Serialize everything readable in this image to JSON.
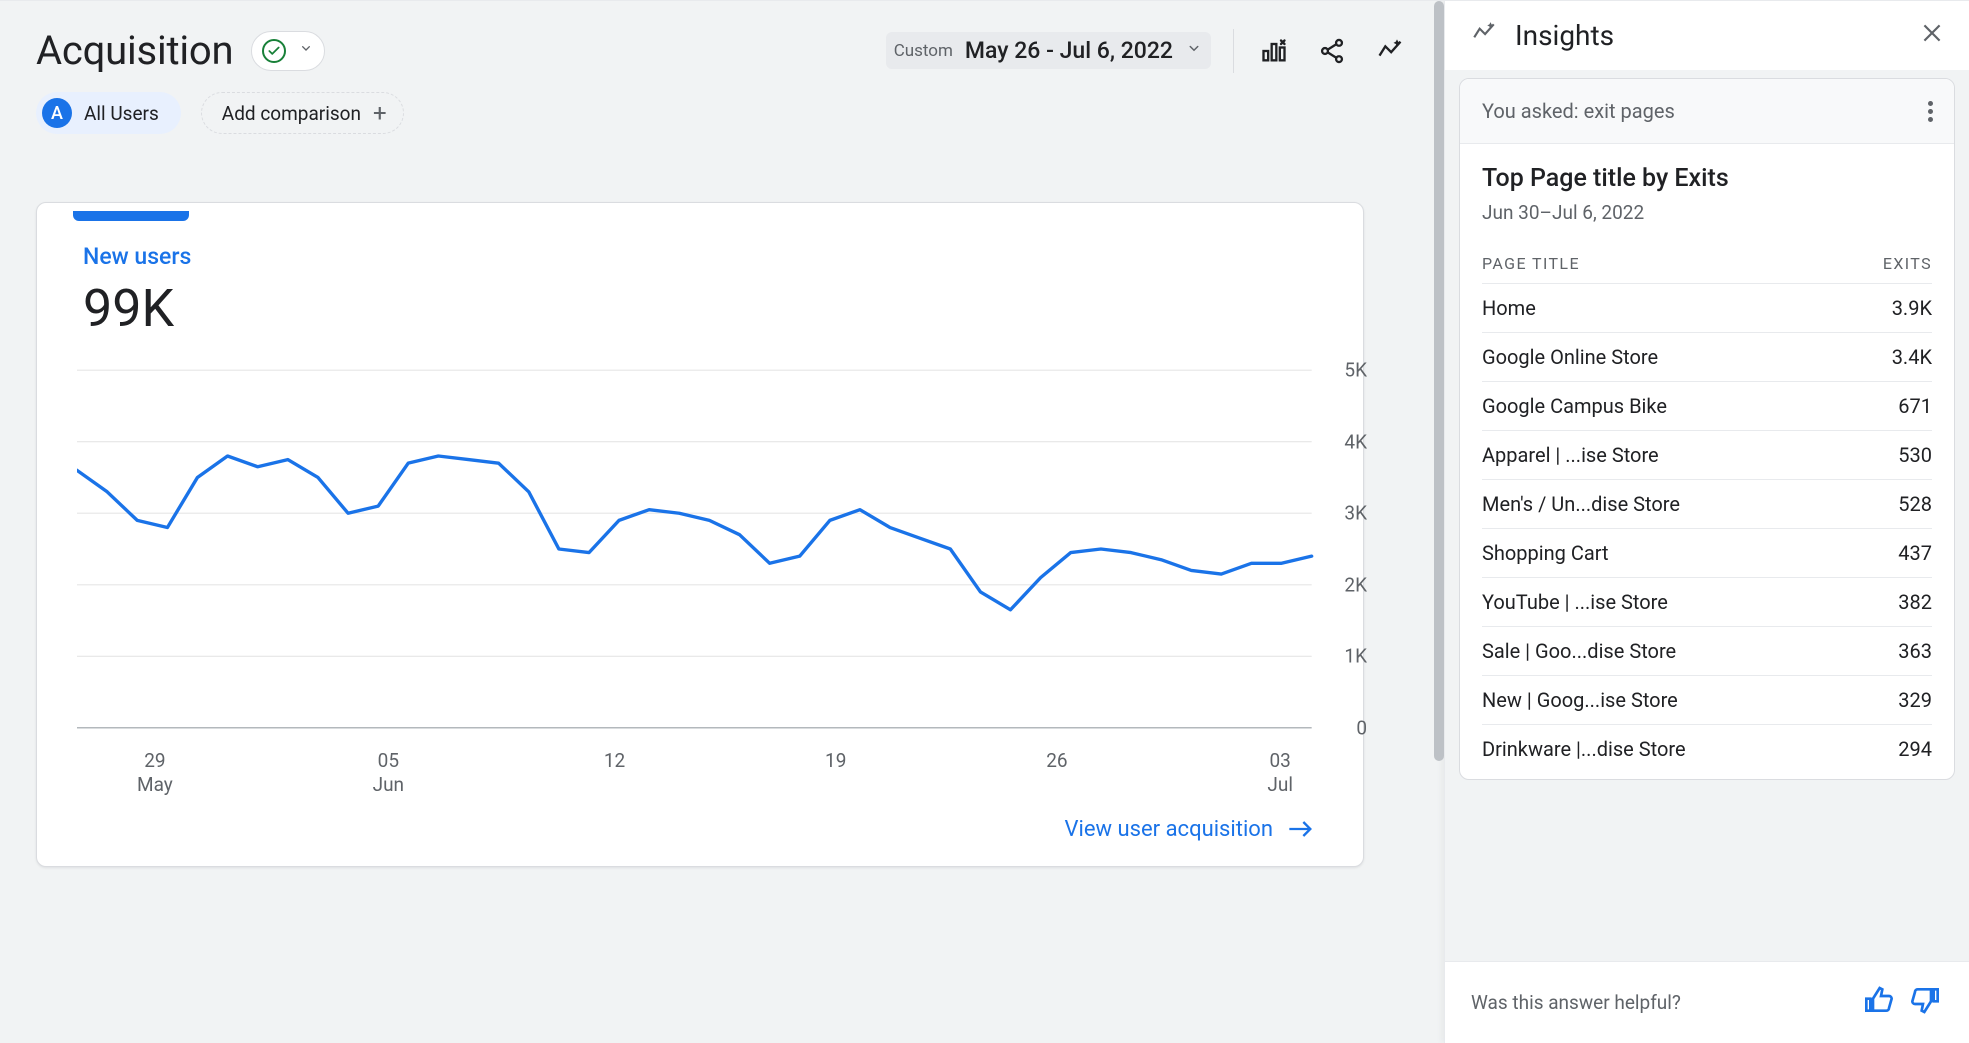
{
  "header": {
    "title": "Acquisition",
    "date_label": "Custom",
    "date_range": "May 26 - Jul 6, 2022"
  },
  "segment": {
    "badge": "A",
    "label": "All Users",
    "add_comparison": "Add comparison"
  },
  "card": {
    "metric_label": "New users",
    "metric_value": "99K",
    "view_link": "View user acquisition"
  },
  "chart_data": {
    "type": "line",
    "title": "New users",
    "xlabel": "",
    "ylabel": "",
    "ylim": [
      0,
      5000
    ],
    "yticks": [
      0,
      1000,
      2000,
      3000,
      4000,
      5000
    ],
    "ytick_labels": [
      "0",
      "1K",
      "2K",
      "3K",
      "4K",
      "5K"
    ],
    "x_ticks": [
      "29\nMay",
      "05\nJun",
      "12",
      "19",
      "26",
      "03\nJul"
    ],
    "x": [
      "2022-05-26",
      "2022-05-27",
      "2022-05-28",
      "2022-05-29",
      "2022-05-30",
      "2022-05-31",
      "2022-06-01",
      "2022-06-02",
      "2022-06-03",
      "2022-06-04",
      "2022-06-05",
      "2022-06-06",
      "2022-06-07",
      "2022-06-08",
      "2022-06-09",
      "2022-06-10",
      "2022-06-11",
      "2022-06-12",
      "2022-06-13",
      "2022-06-14",
      "2022-06-15",
      "2022-06-16",
      "2022-06-17",
      "2022-06-18",
      "2022-06-19",
      "2022-06-20",
      "2022-06-21",
      "2022-06-22",
      "2022-06-23",
      "2022-06-24",
      "2022-06-25",
      "2022-06-26",
      "2022-06-27",
      "2022-06-28",
      "2022-06-29",
      "2022-06-30",
      "2022-07-01",
      "2022-07-02",
      "2022-07-03",
      "2022-07-04",
      "2022-07-05",
      "2022-07-06"
    ],
    "series": [
      {
        "name": "New users",
        "values": [
          3600,
          3300,
          2900,
          2800,
          3500,
          3800,
          3650,
          3750,
          3500,
          3000,
          3100,
          3700,
          3800,
          3750,
          3700,
          3300,
          2500,
          2450,
          2900,
          3050,
          3000,
          2900,
          2700,
          2300,
          2400,
          2900,
          3050,
          2800,
          2650,
          2500,
          1900,
          1650,
          2100,
          2450,
          2500,
          2450,
          2350,
          2200,
          2150,
          2300,
          2300,
          2400
        ]
      }
    ]
  },
  "insights": {
    "title": "Insights",
    "asked_prefix": "You asked: ",
    "asked_query": "exit pages",
    "card_title": "Top Page title by Exits",
    "card_subtitle": "Jun 30–Jul 6, 2022",
    "col_page": "PAGE TITLE",
    "col_exits": "EXITS",
    "rows": [
      {
        "title": "Home",
        "exits": "3.9K"
      },
      {
        "title": "Google Online Store",
        "exits": "3.4K"
      },
      {
        "title": "Google Campus Bike",
        "exits": "671"
      },
      {
        "title": "Apparel | ...ise Store",
        "exits": "530"
      },
      {
        "title": "Men's / Un...dise Store",
        "exits": "528"
      },
      {
        "title": "Shopping Cart",
        "exits": "437"
      },
      {
        "title": "YouTube | ...ise Store",
        "exits": "382"
      },
      {
        "title": "Sale | Goo...dise Store",
        "exits": "363"
      },
      {
        "title": "New | Goog...ise Store",
        "exits": "329"
      },
      {
        "title": "Drinkware |...dise Store",
        "exits": "294"
      }
    ],
    "footer_q": "Was this answer helpful?"
  }
}
